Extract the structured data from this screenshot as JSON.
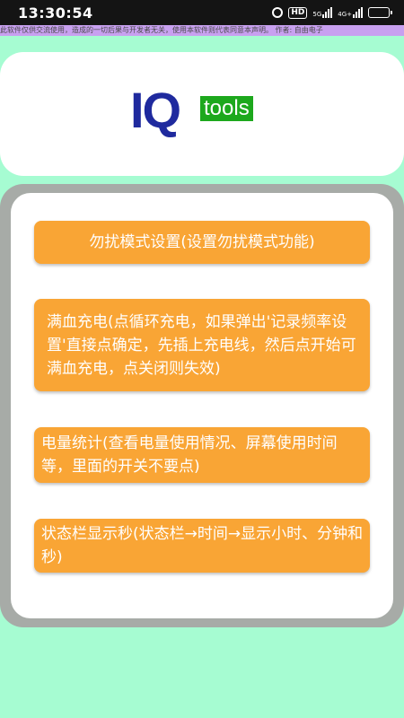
{
  "status_bar": {
    "time": "13:30:54",
    "hd_label": "HD",
    "net_5g": "5G",
    "net_4g": "4G+",
    "icons": [
      "alarm-icon",
      "hd-icon",
      "signal-5g-icon",
      "signal-4g-icon",
      "battery-icon"
    ],
    "battery_level": 0.9
  },
  "disclaimer": "此软件仅供交流使用，造成的一切后果与开发者无关，使用本软件则代表同意本声明。 作者: 自由电子",
  "logo": {
    "main": "IQ",
    "badge": "tools"
  },
  "actions": [
    {
      "label": "勿扰模式设置(设置勿扰模式功能)"
    },
    {
      "label": "满血充电(点循环充电，如果弹出'记录频率设置'直接点确定，先插上充电线，然后点开始可满血充电，点关闭则失效)"
    },
    {
      "label": "电量统计(查看电量使用情况、屏幕使用时间等，里面的开关不要点)"
    },
    {
      "label": "状态栏显示秒(状态栏→时间→显示小时、分钟和秒)"
    }
  ],
  "colors": {
    "background": "#a6fcd2",
    "button": "#f9a535",
    "logo_blue": "#1f2a9e",
    "logo_green": "#1da81d",
    "frame_gray": "#a7aba7"
  }
}
